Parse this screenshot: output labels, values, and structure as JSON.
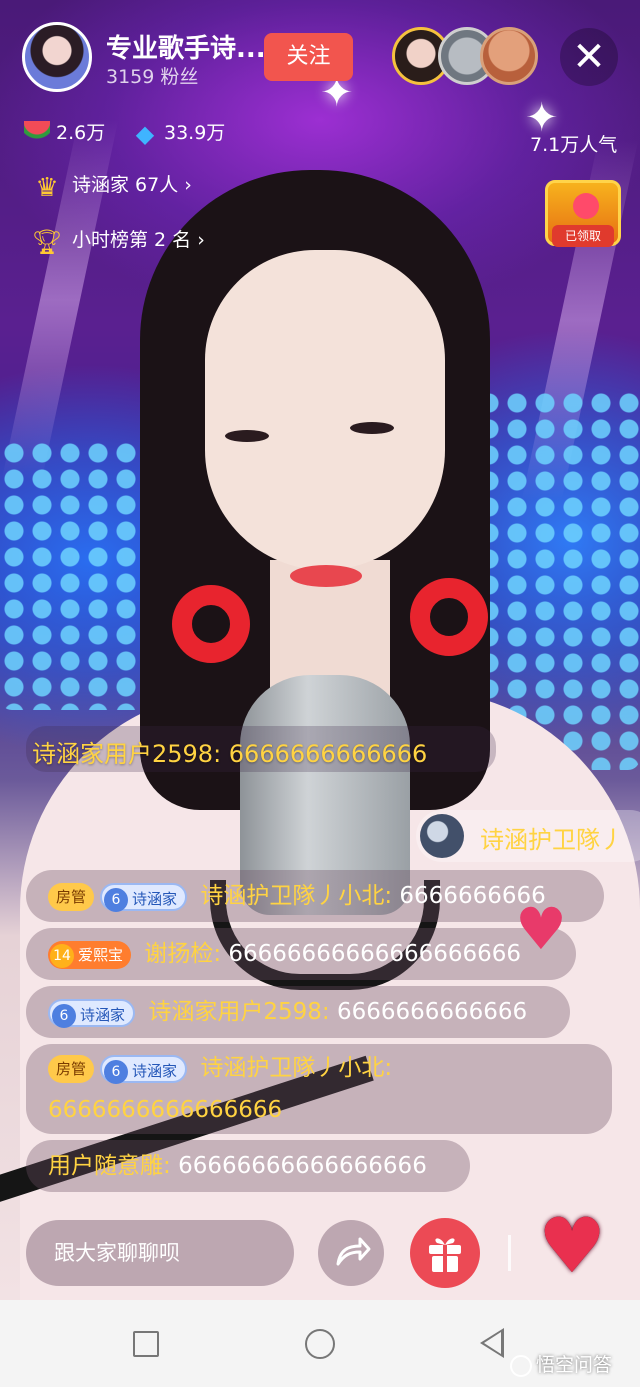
{
  "header": {
    "host_name": "专业歌手诗...",
    "fans": "3159 粉丝",
    "follow_label": "关注",
    "viewers": [
      "viewer-1",
      "viewer-2",
      "viewer-3"
    ],
    "close_icon": "close-icon"
  },
  "stats": {
    "melon": "2.6万",
    "diamond": "33.9万",
    "popularity": "7.1万人气"
  },
  "links": {
    "fan_club": "诗涵家 67人",
    "hourly_rank": "小时榜第 2 名"
  },
  "treasure": {
    "label": "已领取"
  },
  "chat": {
    "floating": "诗涵家用户2598: 6666666666666",
    "entrant": "诗涵护卫隊丿",
    "messages": [
      {
        "admin": "房管",
        "fan_level": "6",
        "fan_club": "诗涵家",
        "name": "诗涵护卫隊丿小北:",
        "text": "6666666666"
      },
      {
        "love_level": "14",
        "love_name": "爱熙宝",
        "name": "谢扬检:",
        "text": "66666666666666666666"
      },
      {
        "fan_level": "6",
        "fan_club": "诗涵家",
        "name": "诗涵家用户2598:",
        "text": "6666666666666"
      },
      {
        "admin": "房管",
        "fan_level": "6",
        "fan_club": "诗涵家",
        "name": "诗涵护卫隊丿小北:",
        "text": "6666666666666666"
      },
      {
        "name": "用户随意雕:",
        "text": "66666666666666666"
      }
    ]
  },
  "controls": {
    "input_placeholder": "跟大家聊聊呗"
  },
  "watermark": "悟空问答",
  "colors": {
    "follow": "#f2554e",
    "username": "#ffd342",
    "gift": "#ec4a55",
    "like": "#e9304f"
  }
}
